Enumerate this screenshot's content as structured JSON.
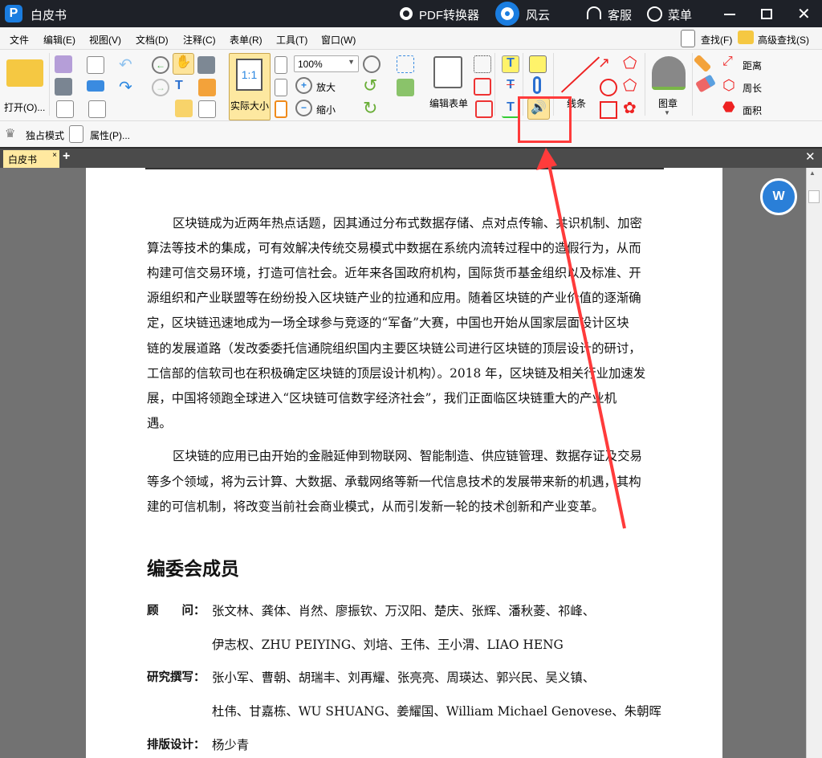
{
  "app": {
    "title": "白皮书",
    "pdf_converter": "PDF转换器",
    "fengyun": "风云",
    "support": "客服",
    "menu": "菜单"
  },
  "menubar": [
    "文件",
    "编辑(E)",
    "视图(V)",
    "文档(D)",
    "注释(C)",
    "表单(R)",
    "工具(T)",
    "窗口(W)"
  ],
  "search": {
    "find": "查找(F)",
    "advanced_find": "高级查找(S)"
  },
  "ribbon": {
    "open": "打开(O)...",
    "actual_size": "实际大小",
    "zoom_value": "100%",
    "zoom_in": "放大",
    "zoom_out": "缩小",
    "edit_form": "编辑表单",
    "lines": "线条",
    "stamp": "图章",
    "distance": "距离",
    "perimeter": "周长",
    "area": "面积",
    "exclusive_mode": "独占模式",
    "properties": "属性(P)..."
  },
  "tabs": [
    {
      "label": "白皮书",
      "active": true
    }
  ],
  "highlight_color": "#ff3b3b",
  "document": {
    "para1": [
      "区块链成为近两年热点话题，因其通过分布式数据存储、点对点传输、共识机制、加密",
      "算法等技术的集成，可有效解决传统交易模式中数据在系统内流转过程中的造假行为，从而",
      "构建可信交易环境，打造可信社会。近年来各国政府机构，国际货币基金组织以及标准、开",
      "源组织和产业联盟等在纷纷投入区块链产业的拉通和应用。随着区块链的产业价值的逐渐确",
      "定，区块链迅速地成为一场全球参与竞逐的“军备”大赛，中国也开始从国家层面设计区块",
      "链的发展道路（发改委委托信通院组织国内主要区块链公司进行区块链的顶层设计的研讨，",
      "工信部的信软司也在积极确定区块链的顶层设计机构）。2018 年，区块链及相关行业加速发",
      "展，中国将领跑全球进入“区块链可信数字经济社会”，我们正面临区块链重大的产业机",
      "遇。"
    ],
    "para2": [
      "区块链的应用已由开始的金融延伸到物联网、智能制造、供应链管理、数据存证及交易",
      "等多个领域，将为云计算、大数据、承载网络等新一代信息技术的发展带来新的机遇，其构",
      "建的可信机制，将改变当前社会商业模式，从而引发新一轮的技术创新和产业变革。"
    ],
    "heading": "编委会成员",
    "members": [
      {
        "label": "顾　　问：",
        "lines": [
          "张文林、龚体、肖然、廖振钦、万汉阳、楚庆、张辉、潘秋菱、祁峰、",
          "伊志权、ZHU PEIYING、刘培、王伟、王小渭、LIAO HENG"
        ]
      },
      {
        "label": "研究撰写：",
        "lines": [
          "张小军、曹朝、胡瑞丰、刘再耀、张亮亮、周瑛达、郭兴民、吴义镇、",
          "杜伟、甘嘉栋、WU SHUANG、姜耀国、William Michael Genovese、朱朝晖"
        ]
      },
      {
        "label": "排版设计：",
        "lines": [
          "杨少青"
        ]
      }
    ]
  }
}
